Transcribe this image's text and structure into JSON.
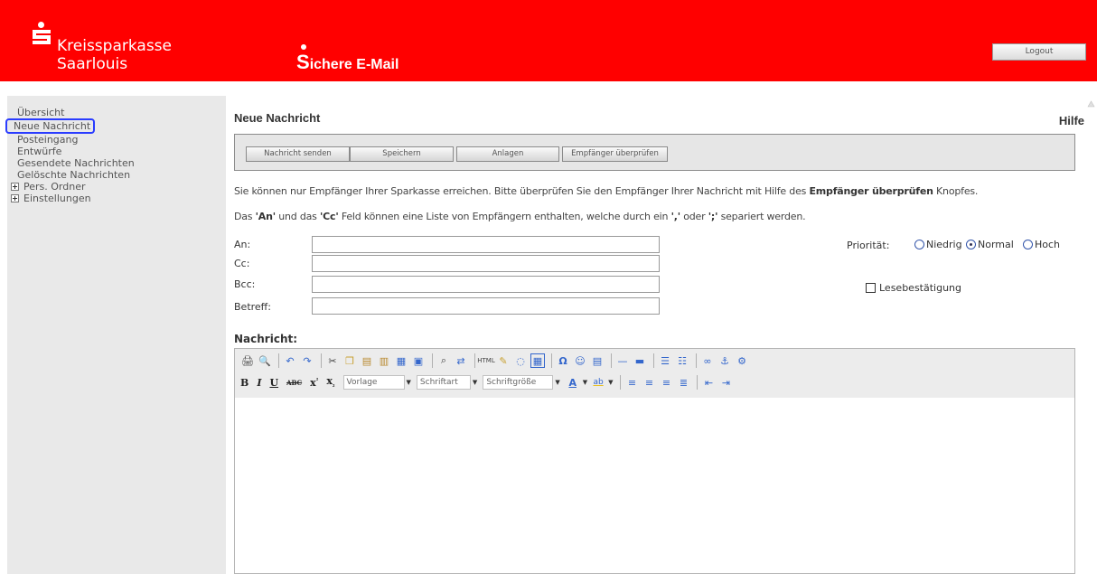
{
  "header": {
    "bank_name_line1": "Kreissparkasse",
    "bank_name_line2": "Saarlouis",
    "app_title_first": "S",
    "app_title_rest": "ichere E-Mail",
    "logout_label": "Logout",
    "bg_color": "#ff0000"
  },
  "sidebar": {
    "items": [
      {
        "label": "Übersicht"
      },
      {
        "label": "Neue Nachricht",
        "active": true
      },
      {
        "label": "Posteingang"
      },
      {
        "label": "Entwürfe"
      },
      {
        "label": "Gesendete Nachrichten"
      },
      {
        "label": "Gelöschte Nachrichten"
      }
    ],
    "folders": [
      {
        "label": "Pers. Ordner"
      },
      {
        "label": "Einstellungen"
      }
    ]
  },
  "main": {
    "title": "Neue Nachricht",
    "help": "Hilfe",
    "toolbar": {
      "send": "Nachricht senden",
      "save": "Speichern",
      "attachments": "Anlagen",
      "check_recipients": "Empfänger überprüfen"
    },
    "info1_prefix": "Sie können nur Empfänger Ihrer Sparkasse erreichen. Bitte überprüfen Sie den Empfänger Ihrer Nachricht mit Hilfe des ",
    "info1_bold": "Empfänger überprüfen",
    "info1_suffix": " Knopfes.",
    "info2_a": "Das ",
    "info2_an": "'An'",
    "info2_b": " und das ",
    "info2_cc": "'Cc'",
    "info2_c": " Feld können eine Liste von Empfängern enthalten, welche durch ein ",
    "info2_comma": "','",
    "info2_d": " oder ",
    "info2_semicolon": "';'",
    "info2_e": " separiert werden.",
    "fields": {
      "to_label": "An:",
      "cc_label": "Cc:",
      "bcc_label": "Bcc:",
      "subject_label": "Betreff:",
      "to_value": "",
      "cc_value": "",
      "bcc_value": "",
      "subject_value": ""
    },
    "priority": {
      "label": "Priorität:",
      "options": [
        "Niedrig",
        "Normal",
        "Hoch"
      ],
      "selected": "Normal"
    },
    "read_receipt": {
      "label": "Lesebestätigung",
      "checked": false
    },
    "message_label": "Nachricht:"
  },
  "editor": {
    "style_select": "Vorlage",
    "font_select": "Schriftart",
    "size_select": "Schriftgröße",
    "body": ""
  }
}
